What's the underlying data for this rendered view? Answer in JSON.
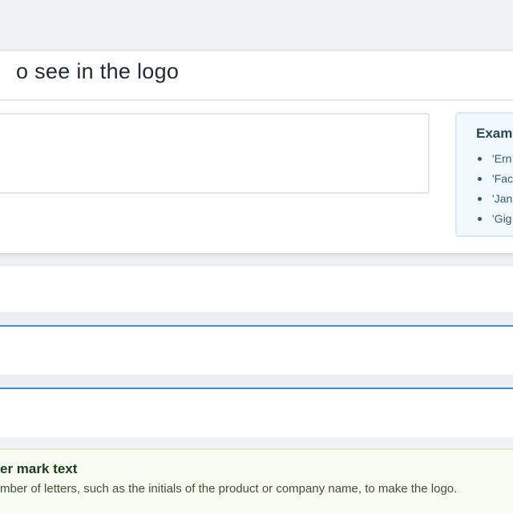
{
  "card": {
    "title": "o see in the logo"
  },
  "examples": {
    "title": "Examp",
    "items": [
      "'Ern",
      "'Fac",
      "'Jan",
      "'Gig"
    ]
  },
  "lettermark": {
    "title": "er mark text",
    "description": "mber of letters, such as the initials of the product or company name, to make the logo."
  },
  "colors": {
    "accent_blue": "#3a8fd6",
    "examples_bg": "#f1f9fd",
    "lettermark_bg": "#f6fdf0"
  }
}
